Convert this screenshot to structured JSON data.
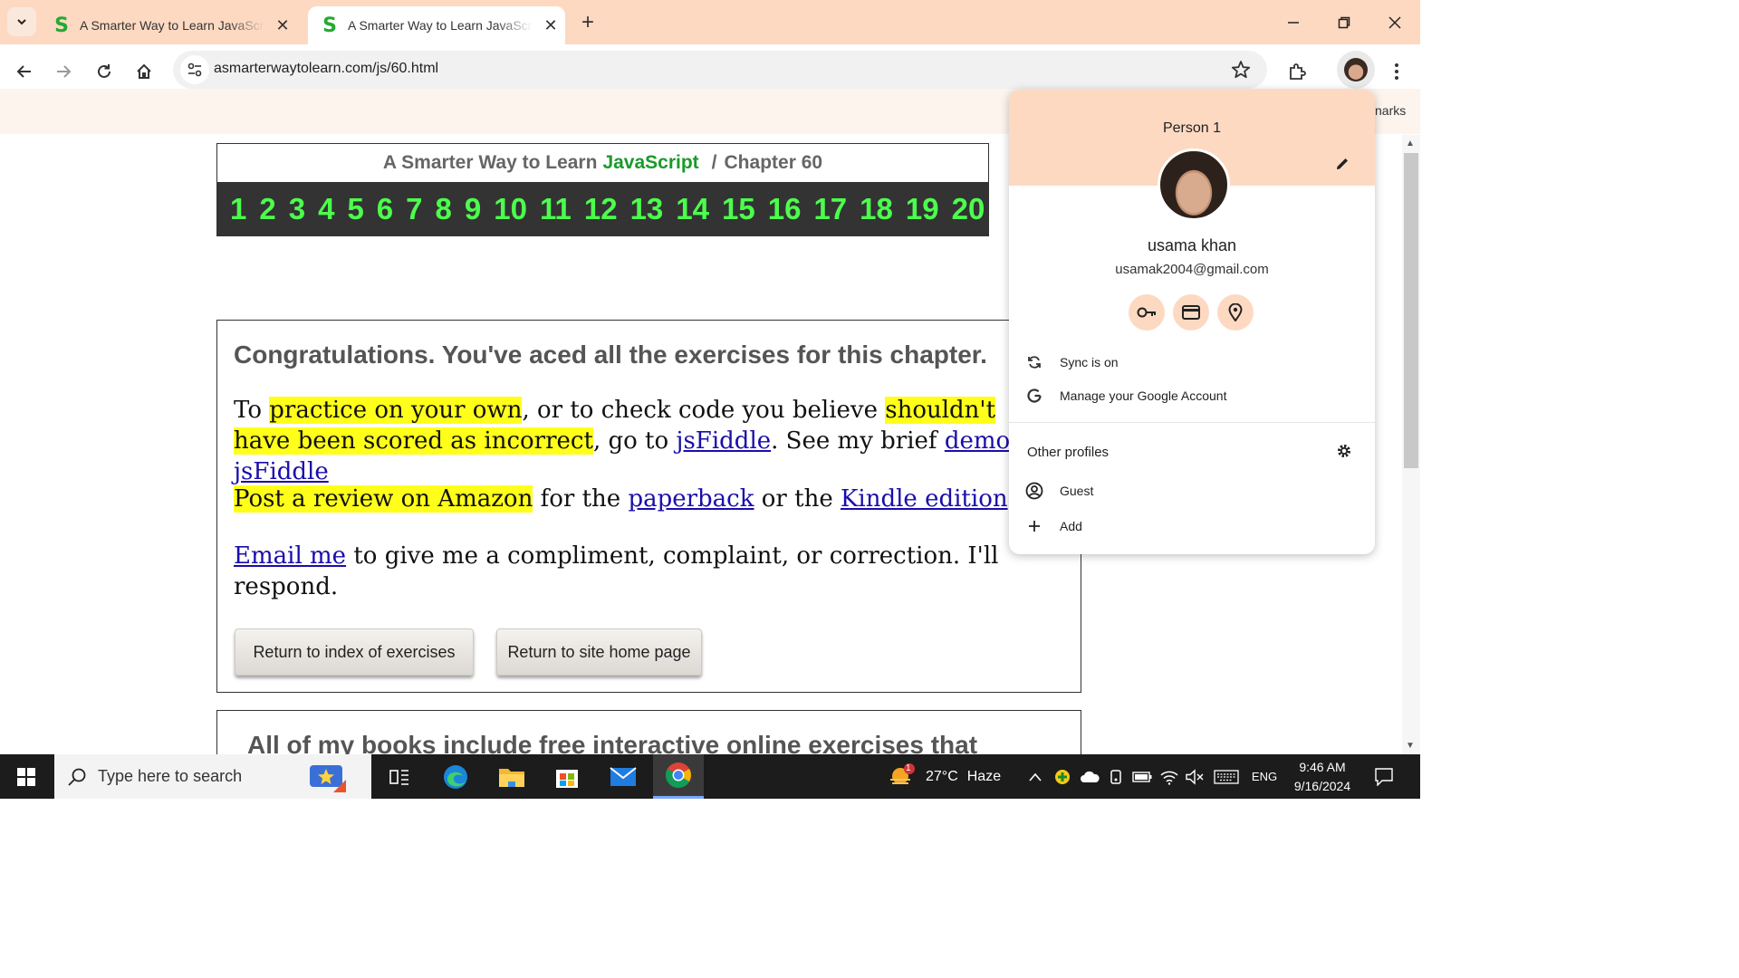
{
  "browser": {
    "tabs": [
      {
        "title": "A Smarter Way to Learn JavaScript",
        "favicon": "S",
        "active": false
      },
      {
        "title": "A Smarter Way to Learn JavaScript",
        "favicon": "S",
        "active": true
      }
    ],
    "url": "asmarterwaytolearn.com/js/60.html",
    "bookmarks_fragment": "narks",
    "theme_color": "#fdd9c2"
  },
  "chapter_nav": {
    "title_prefix": "A Smarter Way to Learn",
    "title_js": "JavaScript",
    "separator": "/",
    "chapter": "Chapter 60",
    "numbers": [
      "1",
      "2",
      "3",
      "4",
      "5",
      "6",
      "7",
      "8",
      "9",
      "10",
      "11",
      "12",
      "13",
      "14",
      "15",
      "16",
      "17",
      "18",
      "19",
      "20"
    ]
  },
  "congrats": {
    "title": "Congratulations. You've aced all the exercises for this chapter.",
    "p1": {
      "t1": "To ",
      "h1": "practice on your own",
      "t2": ", or to check code you believe ",
      "h2": "shouldn't have been scored as incorrect",
      "t3": ", go to ",
      "l1": "jsFiddle",
      "t4": ". See my brief ",
      "l2": "demo of jsFiddle"
    },
    "p2": {
      "h1": "Post a review on Amazon",
      "t1": " for the ",
      "l1": "paperback",
      "t2": " or the ",
      "l2": "Kindle edition",
      "t3": "."
    },
    "p3": {
      "l1": "Email me",
      "t1": " to give me a compliment, complaint, or correction. I'll respond."
    },
    "btn_index": "Return to index of exercises",
    "btn_home": "Return to site home page"
  },
  "books": {
    "title": "All of my books include free interactive online exercises that"
  },
  "profile_menu": {
    "person": "Person 1",
    "name": "usama khan",
    "email": "usamak2004@gmail.com",
    "sync": "Sync is on",
    "manage": "Manage your Google Account",
    "other_profiles": "Other profiles",
    "guest": "Guest",
    "add": "Add",
    "quick_actions": [
      "key-icon",
      "card-icon",
      "location-pin-icon"
    ]
  },
  "taskbar": {
    "search_placeholder": "Type here to search",
    "weather_temp": "27°C",
    "weather_desc": "Haze",
    "weather_badge": "1",
    "lang": "ENG",
    "time": "9:46 AM",
    "date": "9/16/2024"
  }
}
